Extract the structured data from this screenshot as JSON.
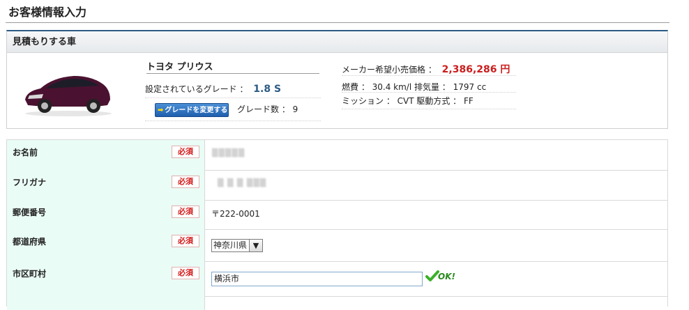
{
  "page": {
    "title": "お客様情報入力"
  },
  "car_section": {
    "header": "見積もりする車",
    "car_name": "トヨタ プリウス",
    "grade_label": "設定されているグレード ：",
    "grade_value": "1.8 S",
    "change_button_label": "グレードを変更する",
    "grade_count_label": "グレード数 ： 9",
    "price_label": "メーカー希望小売価格 ：",
    "price_value": "2,386,286 円",
    "spec_line1": "燃費 ： 30.4 km/l 排気量 ： 1797 cc",
    "spec_line2": "ミッション ： CVT 駆動方式 ： FF",
    "car_color": "#4a1230"
  },
  "form": {
    "required_label": "必須",
    "rows": [
      {
        "label": "お名前"
      },
      {
        "label": "フリガナ"
      },
      {
        "label": "郵便番号",
        "value": "〒222-0001"
      },
      {
        "label": "都道府県",
        "selected": "神奈川県"
      },
      {
        "label": "市区町村",
        "value": "横浜市",
        "status": "OK!"
      }
    ]
  },
  "colors": {
    "accent": "#2b5b84",
    "required": "#d21a1a",
    "price": "#cc1d1d",
    "label_bg": "#eafcf6",
    "ok": "#2a8a1f"
  }
}
